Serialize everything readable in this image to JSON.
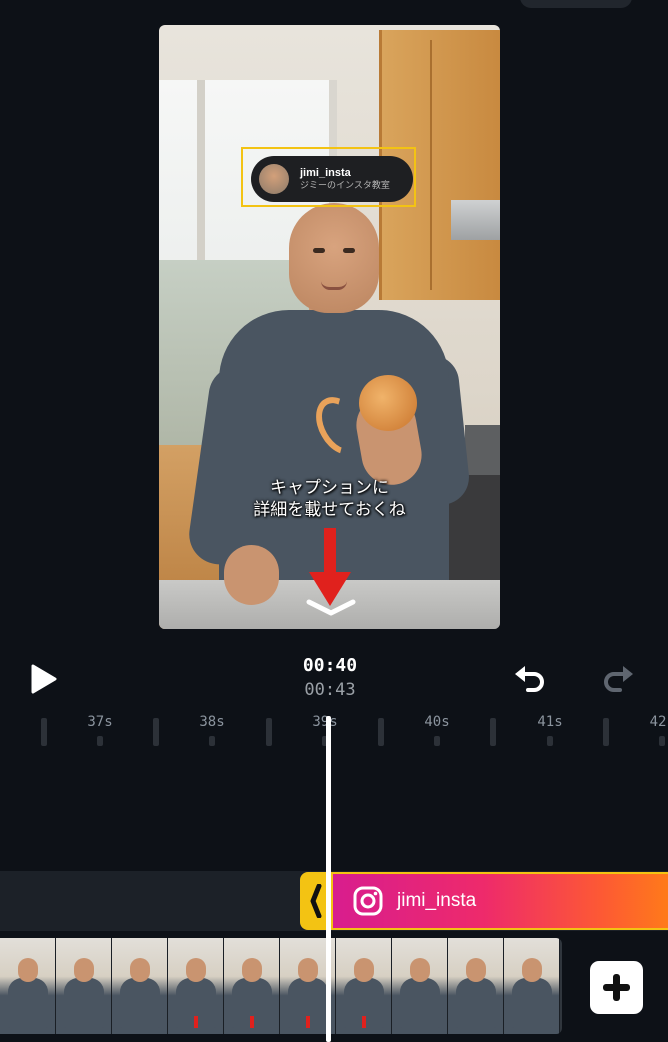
{
  "preview": {
    "sticker": {
      "username": "jimi_insta",
      "subtitle": "ジミーのインスタ教室"
    },
    "caption": {
      "line1": "キャプションに",
      "line2": "詳細を載せておくね"
    }
  },
  "controls": {
    "current_time": "00:40",
    "total_time": "00:43"
  },
  "ruler": {
    "labels": [
      "37s",
      "38s",
      "39s",
      "40s",
      "41s",
      "42"
    ]
  },
  "timeline": {
    "overlay_clip": {
      "label": "jimi_insta",
      "icon": "instagram-icon"
    },
    "add_button_icon": "plus-icon"
  },
  "colors": {
    "selection": "#f3c313",
    "background": "#0d1117"
  }
}
